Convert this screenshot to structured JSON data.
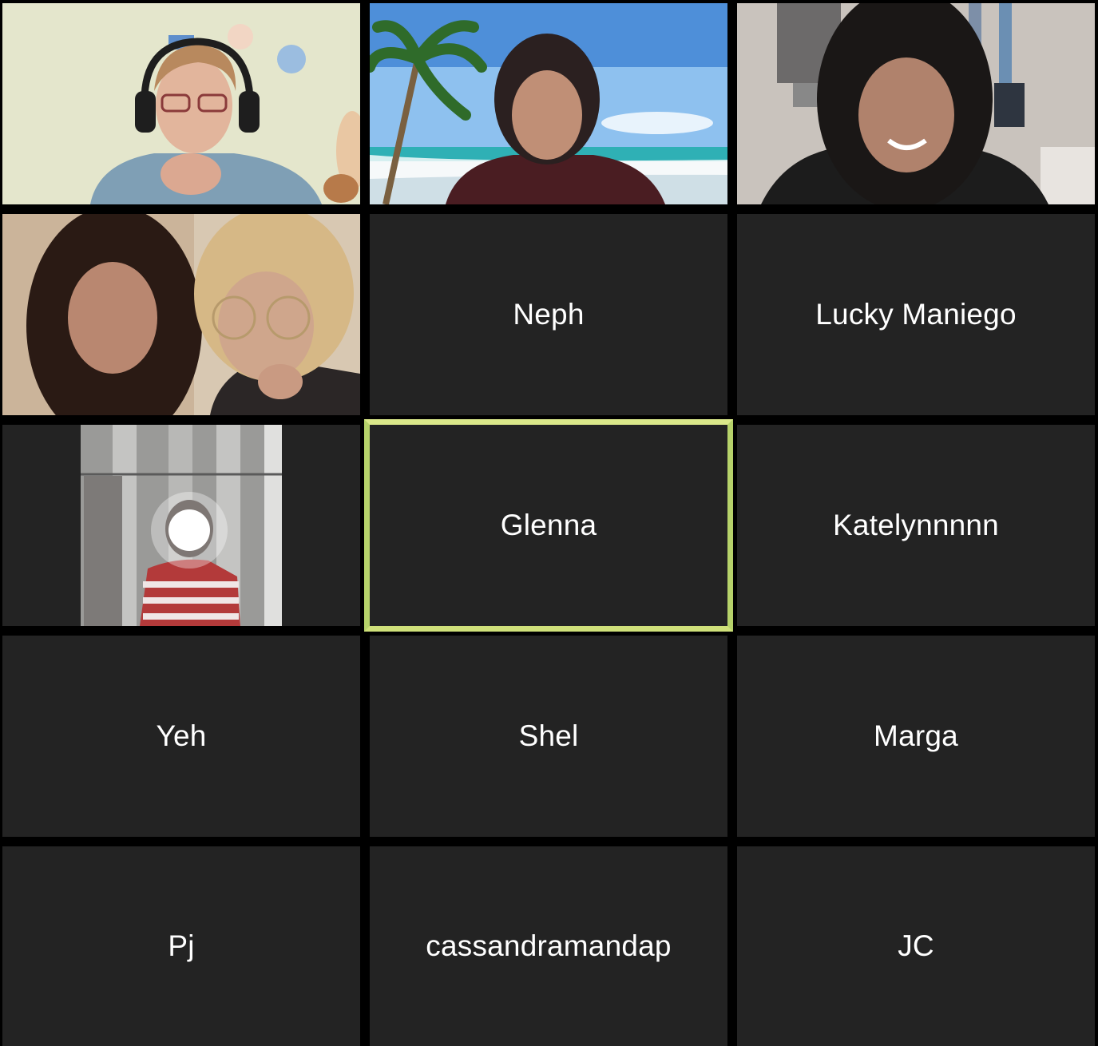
{
  "meeting": {
    "participants": [
      {
        "name": "",
        "video": true,
        "scene": "man-with-headset"
      },
      {
        "name": "",
        "video": true,
        "scene": "beach-background"
      },
      {
        "name": "",
        "video": true,
        "scene": "girl-smiling"
      },
      {
        "name": "",
        "video": true,
        "scene": "two-girls"
      },
      {
        "name": "Neph",
        "video": false
      },
      {
        "name": "Lucky Maniego",
        "video": false
      },
      {
        "name": "",
        "video": true,
        "scene": "mirror-selfie"
      },
      {
        "name": "Glenna",
        "video": false,
        "active_speaker": true
      },
      {
        "name": "Katelynnnnn",
        "video": false
      },
      {
        "name": "Yeh",
        "video": false
      },
      {
        "name": "Shel",
        "video": false
      },
      {
        "name": "Marga",
        "video": false
      },
      {
        "name": "Pj",
        "video": false
      },
      {
        "name": "cassandramandap",
        "video": false
      },
      {
        "name": "JC",
        "video": false
      }
    ]
  },
  "colors": {
    "tile_bg": "#232323",
    "gutter": "#000000",
    "name_text": "#ffffff",
    "active_speaker_border": "#cfe07a"
  }
}
